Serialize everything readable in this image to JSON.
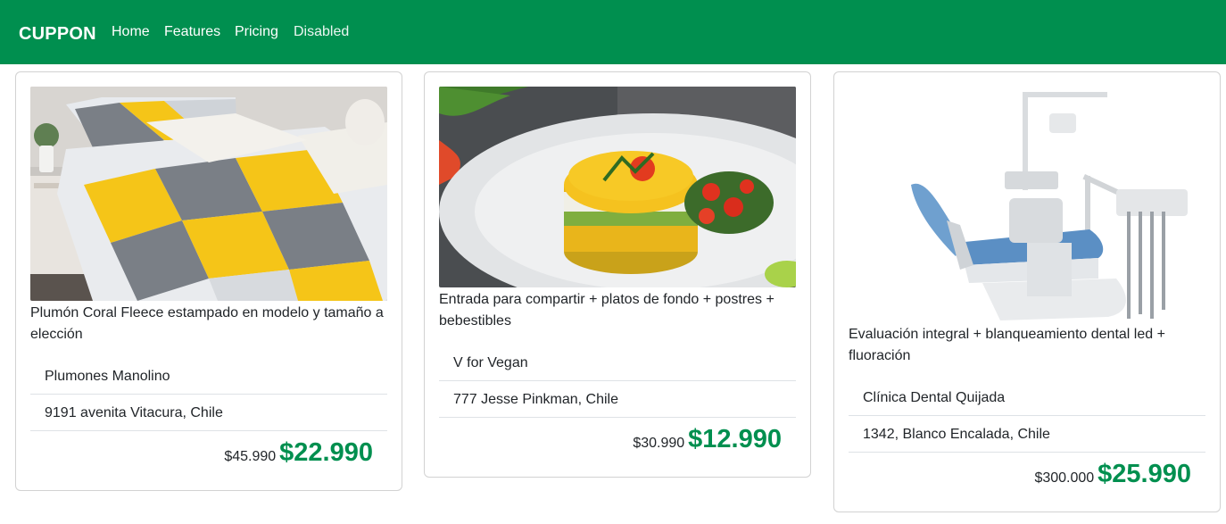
{
  "navbar": {
    "brand": "CUPPON",
    "links": [
      "Home",
      "Features",
      "Pricing",
      "Disabled"
    ],
    "color": "#008f4f"
  },
  "cards": [
    {
      "image": "comforter-bed-photo",
      "title": "Plumón Coral Fleece estampado en modelo y tamaño a elección",
      "merchant": "Plumones Manolino",
      "address": "9191 avenita Vitacura, Chile",
      "old_price": "$45.990",
      "new_price": "$22.990"
    },
    {
      "image": "causa-dish-photo",
      "title": "Entrada para compartir + platos de fondo + postres + bebestibles",
      "merchant": "V for Vegan",
      "address": "777 Jesse Pinkman, Chile",
      "old_price": "$30.990",
      "new_price": "$12.990"
    },
    {
      "image": "dental-chair-photo",
      "title": "Evaluación integral + blanqueamiento dental led + fluoración",
      "merchant": "Clínica Dental Quijada",
      "address": "1342, Blanco Encalada, Chile",
      "old_price": "$300.000",
      "new_price": "$25.990"
    }
  ]
}
